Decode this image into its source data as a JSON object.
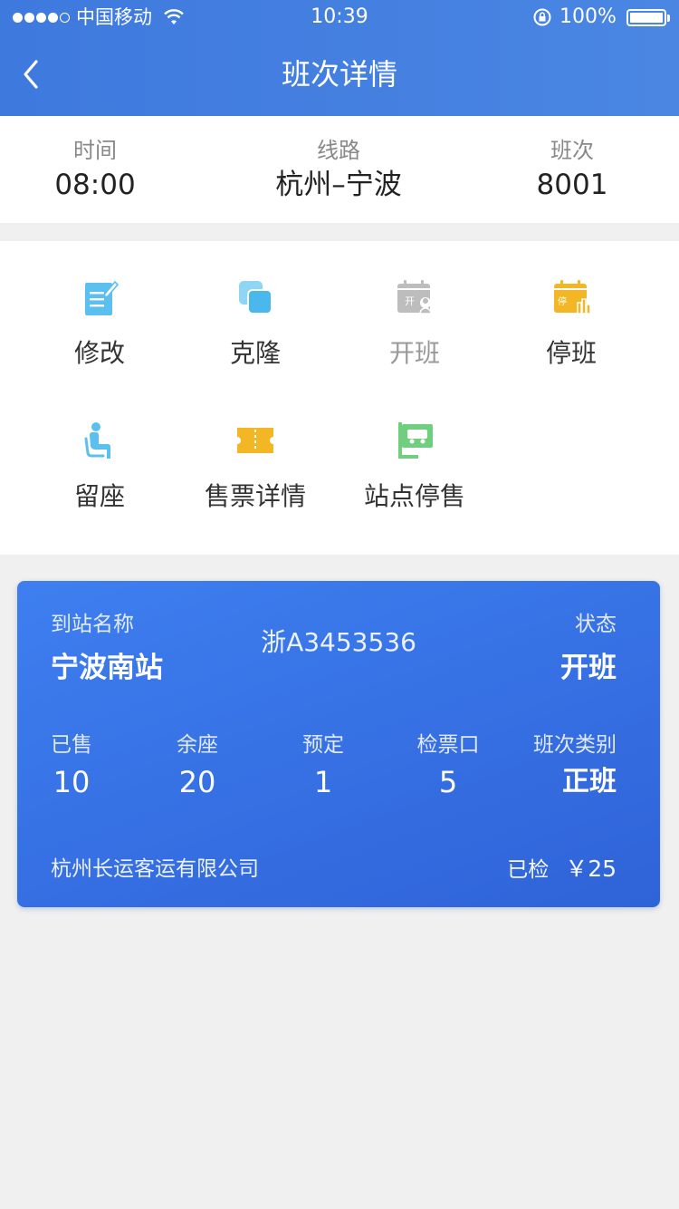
{
  "status_bar": {
    "carrier": "中国移动",
    "time": "10:39",
    "battery": "100%"
  },
  "nav": {
    "title": "班次详情"
  },
  "summary": [
    {
      "label": "时间",
      "value": "08:00"
    },
    {
      "label": "线路",
      "value": "杭州–宁波"
    },
    {
      "label": "班次",
      "value": "8001"
    }
  ],
  "actions": [
    {
      "label": "修改",
      "icon": "edit-icon",
      "color": "#5bc0f0"
    },
    {
      "label": "克隆",
      "icon": "clone-icon",
      "color": "#5bc0f0"
    },
    {
      "label": "开班",
      "icon": "open-shift-icon",
      "color": "#bbbbbb"
    },
    {
      "label": "停班",
      "icon": "stop-shift-icon",
      "color": "#f3b725"
    },
    {
      "label": "留座",
      "icon": "seat-icon",
      "color": "#5bc0f0"
    },
    {
      "label": "售票详情",
      "icon": "ticket-icon",
      "color": "#f3b725"
    },
    {
      "label": "站点停售",
      "icon": "station-stop-icon",
      "color": "#6fcf7f"
    }
  ],
  "card": {
    "dest_label": "到站名称",
    "dest_value": "宁波南站",
    "plate": "浙A3453536",
    "state_label": "状态",
    "state_value": "开班",
    "stats": [
      {
        "label": "已售",
        "value": "10"
      },
      {
        "label": "余座",
        "value": "20"
      },
      {
        "label": "预定",
        "value": "1"
      },
      {
        "label": "检票口",
        "value": "5"
      },
      {
        "label": "班次类别",
        "value": "正班"
      }
    ],
    "company": "杭州长运客运有限公司",
    "checked_label": "已检",
    "price": "￥25"
  },
  "colors": {
    "header": "#3e79de",
    "card": "#3a75e8"
  }
}
